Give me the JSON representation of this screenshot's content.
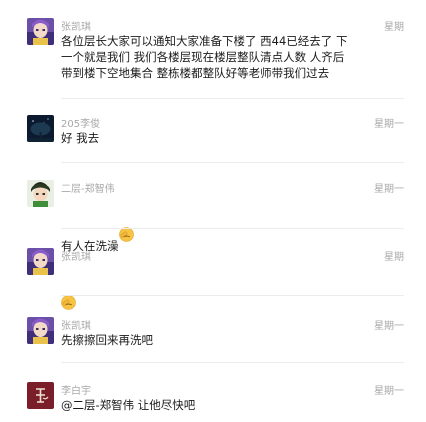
{
  "messages": [
    {
      "sender": "张凯琪",
      "time": "星期",
      "avatar": "anime-girl-purple-avatar",
      "text": "各位层长大家可以通知大家准备下楼了 西44已经去了 下\n一个就是我们 我们各楼层现在楼层整队清点人数 人齐后\n带到楼下空地集合 整栋楼都整队好等老师带我们过去"
    },
    {
      "sender": "205李俊",
      "time": "星期一",
      "avatar": "night-tree-avatar",
      "text": "好 我去"
    },
    {
      "sender": "二层-郑智伟",
      "time": "星期一",
      "avatar": "anime-boy-green-avatar",
      "text": "有人在洗澡",
      "emoji": "facepalm-emoji"
    },
    {
      "sender": "张凯琪",
      "time": "星期",
      "avatar": "anime-girl-purple-avatar",
      "text": "",
      "emoji": "facepalm-emoji"
    },
    {
      "sender": "张凯琪",
      "time": "星期一",
      "avatar": "anime-girl-purple-avatar",
      "text": "先擦擦回来再洗吧"
    },
    {
      "sender": "李白宇",
      "time": "星期一",
      "avatar": "red-seal-avatar",
      "text": "@二层-郑智伟 让他尽快吧"
    }
  ],
  "colors": {
    "name_gray": "#a8a8a8",
    "text": "#1a1a1a",
    "divider": "#ececec"
  }
}
